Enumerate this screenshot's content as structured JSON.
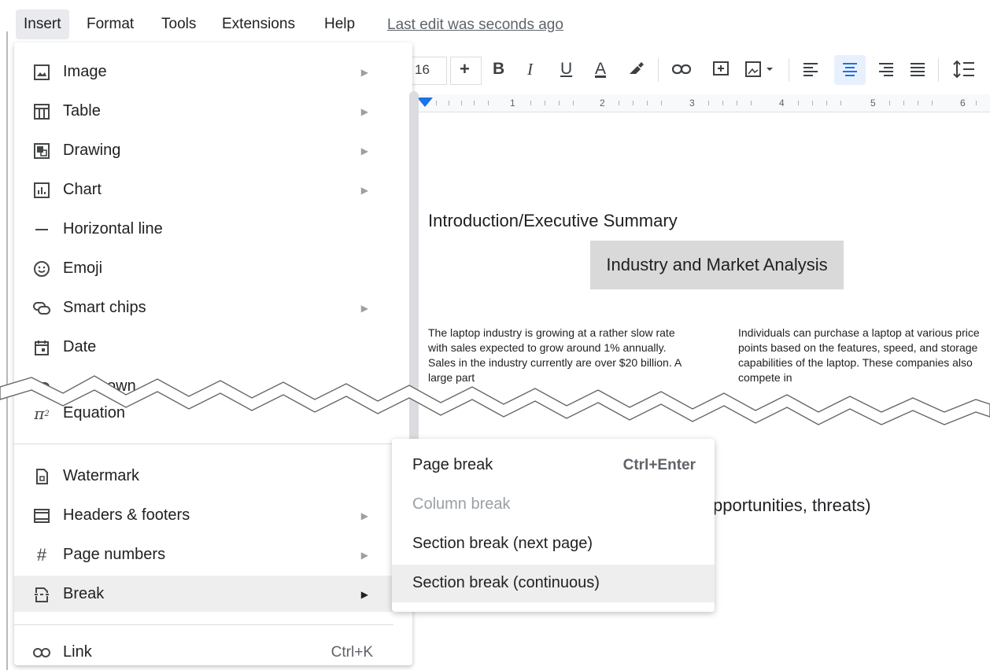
{
  "menubar": {
    "items": [
      "Insert",
      "Format",
      "Tools",
      "Extensions",
      "Help"
    ],
    "last_edit": "Last edit was seconds ago"
  },
  "toolbar": {
    "font_size": "16",
    "plus": "+",
    "bold": "B",
    "italic": "I",
    "underline": "U",
    "text_color": "A"
  },
  "ruler": {
    "numbers": [
      "1",
      "2",
      "3",
      "4",
      "5",
      "6"
    ]
  },
  "document": {
    "heading": "Introduction/Executive Summary",
    "subheading": "Industry and Market Analysis",
    "para1": "The laptop industry is growing at a rather slow rate with sales expected to grow around 1% annually.  Sales in the industry currently are over $20 billion.  A large part",
    "para2": " Individuals can purchase a laptop at various price points based on the features, speed, and storage capabilities of the laptop. These companies also compete in",
    "swot_fragment": "pportunities, threats)"
  },
  "insert_menu": {
    "items": [
      {
        "label": "Image",
        "icon": "image-icon",
        "arrow": true
      },
      {
        "label": "Table",
        "icon": "table-icon",
        "arrow": true
      },
      {
        "label": "Drawing",
        "icon": "drawing-icon",
        "arrow": true
      },
      {
        "label": "Chart",
        "icon": "chart-icon",
        "arrow": true
      },
      {
        "label": "Horizontal line",
        "icon": "horizontal-line-icon",
        "arrow": false
      },
      {
        "label": "Emoji",
        "icon": "emoji-icon",
        "arrow": false
      },
      {
        "label": "Smart chips",
        "icon": "smart-chips-icon",
        "arrow": true
      },
      {
        "label": "Date",
        "icon": "date-icon",
        "arrow": false
      },
      {
        "label": "Equation",
        "icon": "equation-icon",
        "arrow": false
      },
      {
        "label": "Watermark",
        "icon": "watermark-icon",
        "arrow": false
      },
      {
        "label": "Headers & footers",
        "icon": "headers-footers-icon",
        "arrow": true
      },
      {
        "label": "Page numbers",
        "icon": "page-numbers-icon",
        "arrow": true
      },
      {
        "label": "Break",
        "icon": "break-icon",
        "arrow": true,
        "highlighted": true
      },
      {
        "label": "Link",
        "icon": "link-icon",
        "shortcut": "Ctrl+K"
      }
    ],
    "partial_dropdown_text": "own"
  },
  "break_submenu": {
    "items": [
      {
        "label": "Page break",
        "shortcut": "Ctrl+Enter",
        "disabled": false
      },
      {
        "label": "Column break",
        "disabled": true
      },
      {
        "label": "Section break (next page)",
        "disabled": false
      },
      {
        "label": "Section break (continuous)",
        "disabled": false,
        "highlighted": true
      }
    ]
  },
  "colors": {
    "accent": "#1a73e8",
    "menu_highlight": "#eeeeee",
    "heading_bg": "#d9d9d9"
  }
}
